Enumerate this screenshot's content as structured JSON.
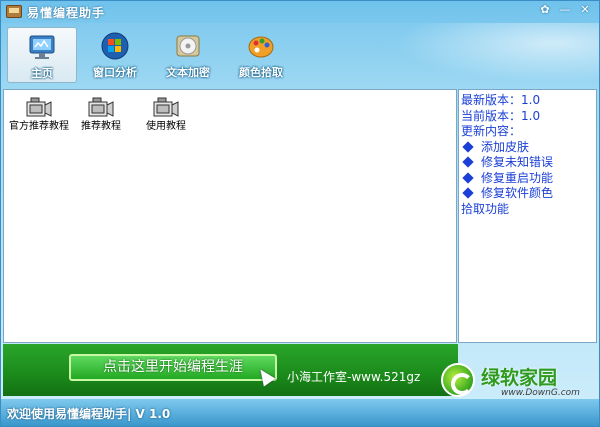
{
  "window": {
    "title": "易懂编程助手"
  },
  "titlebar": {
    "buttons": [
      {
        "name": "skin-button",
        "glyph": "✿"
      },
      {
        "name": "minimize-button",
        "glyph": "—"
      },
      {
        "name": "close-button",
        "glyph": "✕"
      }
    ]
  },
  "toolbar": {
    "items": [
      {
        "label": "主页",
        "icon": "monitor-icon",
        "active": true
      },
      {
        "label": "窗口分析",
        "icon": "windows-logo-icon",
        "active": false
      },
      {
        "label": "文本加密",
        "icon": "disc-icon",
        "active": false
      },
      {
        "label": "颜色拾取",
        "icon": "palette-icon",
        "active": false
      }
    ]
  },
  "shortcuts": [
    {
      "label": "官方推荐教程",
      "icon": "camera-icon"
    },
    {
      "label": "推荐教程",
      "icon": "camera-icon"
    },
    {
      "label": "使用教程",
      "icon": "camera-icon"
    }
  ],
  "info": {
    "latest_version": "最新版本：1.0",
    "current_version": "当前版本：1.0",
    "update_heading": "更新内容：",
    "changes": [
      "添加皮肤",
      "修复未知错误",
      "修复重启功能",
      "修复软件颜色"
    ],
    "changes_tail": "拾取功能"
  },
  "banner": {
    "start_button": "点击这里开始编程生涯",
    "studio_text": "小海工作室-www.521gz"
  },
  "status": {
    "text": "欢迎使用易懂编程助手| V 1.0"
  },
  "watermark": {
    "name": "绿软家园",
    "url": "www.DownG.com"
  },
  "colors": {
    "accent_blue": "#1a3fd6",
    "banner_green": "#1b8a1b",
    "sky": "#6fc2ec"
  }
}
